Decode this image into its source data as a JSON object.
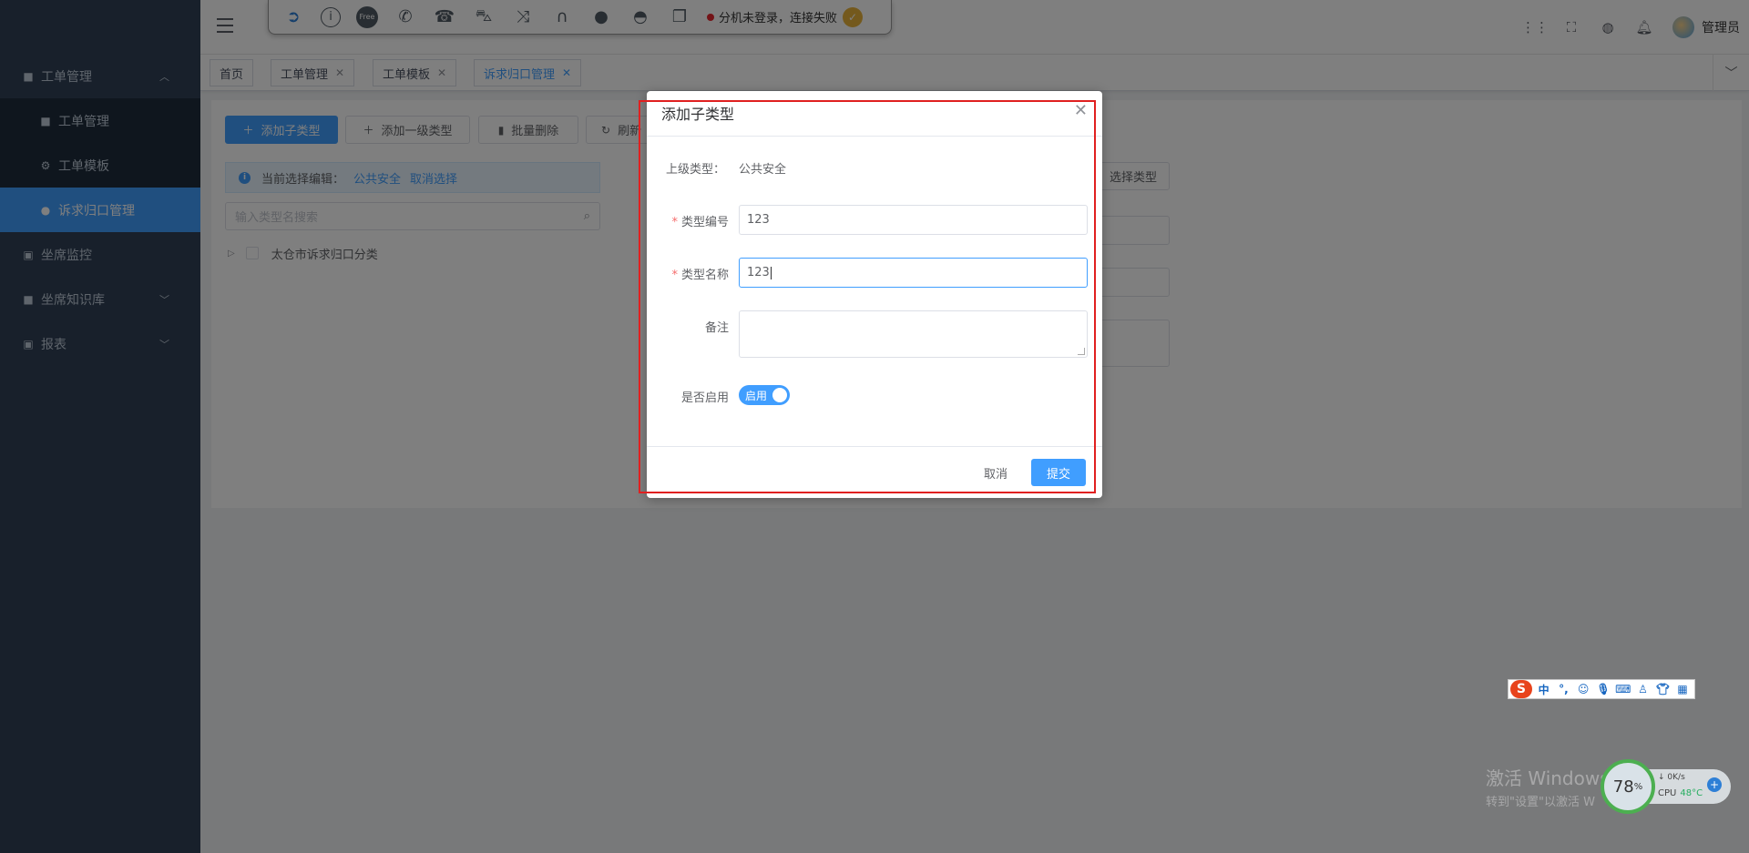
{
  "sidebar": {
    "items": [
      {
        "label": "工单管理",
        "icon": "list-icon",
        "expanded": true
      },
      {
        "label": "坐席监控",
        "icon": "monitor-icon"
      },
      {
        "label": "坐席知识库",
        "icon": "book-icon"
      },
      {
        "label": "报表",
        "icon": "chart-icon"
      }
    ],
    "submenu": [
      {
        "label": "工单管理",
        "icon": "list-icon"
      },
      {
        "label": "工单模板",
        "icon": "gear-icon"
      },
      {
        "label": "诉求归口管理",
        "icon": "user-icon",
        "active": true
      }
    ]
  },
  "toolbar": {
    "free_label": "Free",
    "status_text": "分机未登录，连接失败",
    "status_color": "#e6262e"
  },
  "header": {
    "user_name": "管理员"
  },
  "tags": [
    {
      "label": "首页"
    },
    {
      "label": "工单管理"
    },
    {
      "label": "工单模板"
    },
    {
      "label": "诉求归口管理",
      "active": true
    }
  ],
  "page": {
    "buttons": {
      "add_child": "添加子类型",
      "add_top": "添加一级类型",
      "batch_delete": "批量删除",
      "refresh": "刷新"
    },
    "alert": {
      "prefix": "当前选择编辑：",
      "selected": "公共安全",
      "cancel": "取消选择"
    },
    "tree_search_placeholder": "输入类型名搜索",
    "tree_root": "太仓市诉求归口分类",
    "select_type_button": "选择类型"
  },
  "dialog": {
    "title": "添加子类型",
    "parent_label": "上级类型：",
    "parent_value": "公共安全",
    "code_label": "类型编号",
    "code_value": "123",
    "name_label": "类型名称",
    "name_value": "123",
    "remark_label": "备注",
    "remark_value": "",
    "enabled_label": "是否启用",
    "enabled_text": "启用",
    "enabled": true,
    "cancel": "取消",
    "submit": "提交"
  },
  "colors": {
    "primary": "#409eff",
    "sidebar_bg": "#304156",
    "highlight": "#e02020"
  },
  "ime": {
    "lang": "中",
    "punct": "°,"
  },
  "watermark": {
    "line1": "激活 Windows",
    "line2": "转到\"设置\"以激活 W"
  },
  "monitor": {
    "percent": "78",
    "percent_unit": "%",
    "net": "0K/s",
    "cpu_label": "CPU",
    "cpu_temp": "48°C"
  }
}
